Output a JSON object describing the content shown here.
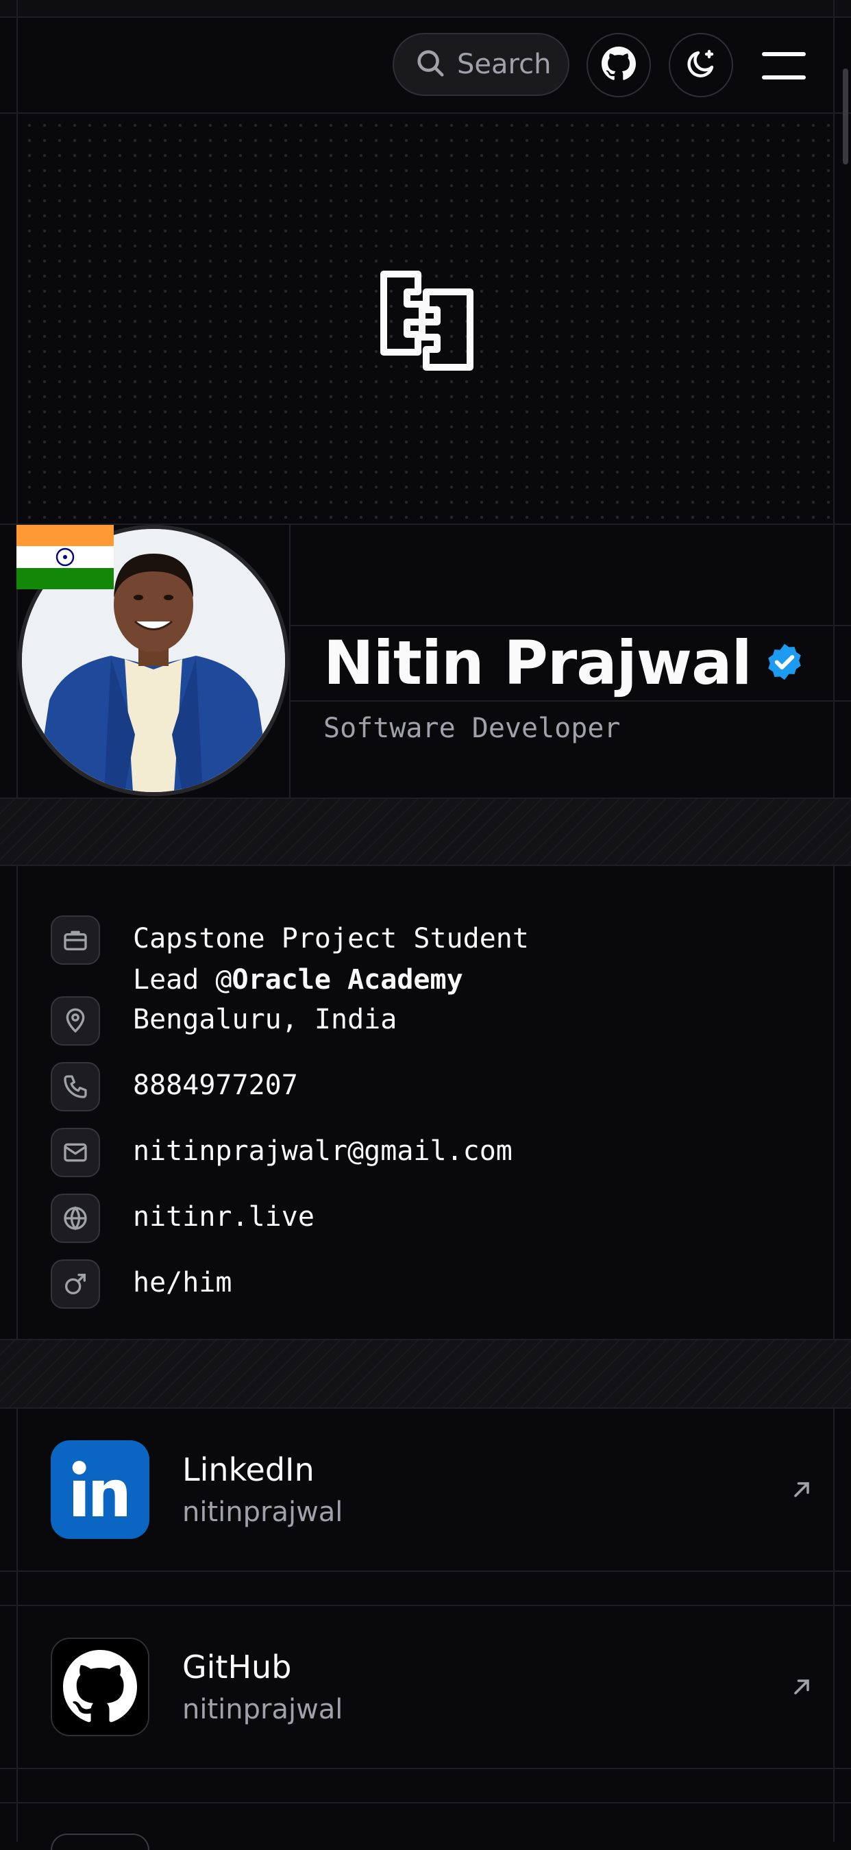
{
  "header": {
    "search_label": "Search"
  },
  "profile": {
    "name": "Nitin Prajwal",
    "role": "Software Developer",
    "verified": true,
    "country_flag": "India"
  },
  "info": {
    "job_line1": "Capstone Project Student",
    "job_line2_prefix": "Lead @",
    "job_company": "Oracle Academy",
    "location": "Bengaluru, India",
    "phone": "8884977207",
    "email": "nitinprajwalr@gmail.com",
    "website": "nitinr.live",
    "pronouns": "he/him"
  },
  "social": [
    {
      "title": "LinkedIn",
      "handle": "nitinprajwal",
      "icon": "linkedin-icon",
      "color": "#0a66c2"
    },
    {
      "title": "GitHub",
      "handle": "nitinprajwal",
      "icon": "github-icon",
      "color": "#000000"
    }
  ],
  "colors": {
    "background": "#09090b",
    "verified_badge": "#1d9bf0",
    "muted_text": "#a1a1aa"
  }
}
